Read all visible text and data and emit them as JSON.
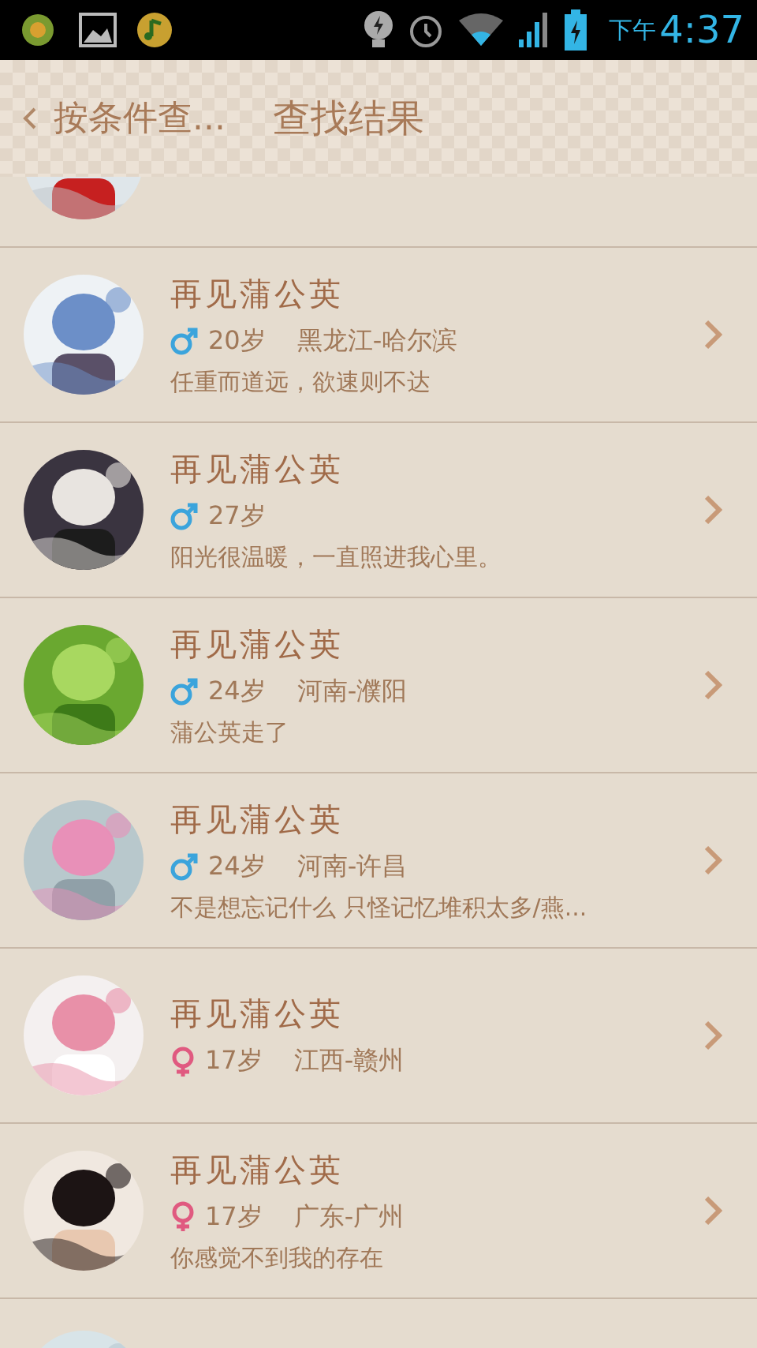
{
  "status_bar": {
    "period": "下午",
    "time": "4:37"
  },
  "header": {
    "back_label": "按条件查...",
    "title": "查找结果"
  },
  "results": [
    {
      "kind": "partial"
    },
    {
      "kind": "full",
      "name": "再见蒲公英",
      "female": false,
      "age": "20岁",
      "location": "黑龙江-哈尔滨",
      "bio": "任重而道远，欲速则不达"
    },
    {
      "kind": "full",
      "name": "再见蒲公英",
      "female": false,
      "age": "27岁",
      "bio": "阳光很温暖，一直照进我心里。"
    },
    {
      "kind": "full",
      "name": "再见蒲公英",
      "female": false,
      "age": "24岁",
      "location": "河南-濮阳",
      "bio": "蒲公英走了"
    },
    {
      "kind": "full",
      "name": "再见蒲公英",
      "female": false,
      "age": "24岁",
      "location": "河南-许昌",
      "bio": "不是想忘记什么 只怪记忆堆积太多/燕..."
    },
    {
      "kind": "full",
      "name": "再见蒲公英",
      "female": true,
      "age": "17岁",
      "location": "江西-赣州"
    },
    {
      "kind": "full",
      "name": "再见蒲公英",
      "female": true,
      "age": "17岁",
      "location": "广东-广州",
      "bio": "你感觉不到我的存在"
    },
    {
      "kind": "cut"
    }
  ]
}
